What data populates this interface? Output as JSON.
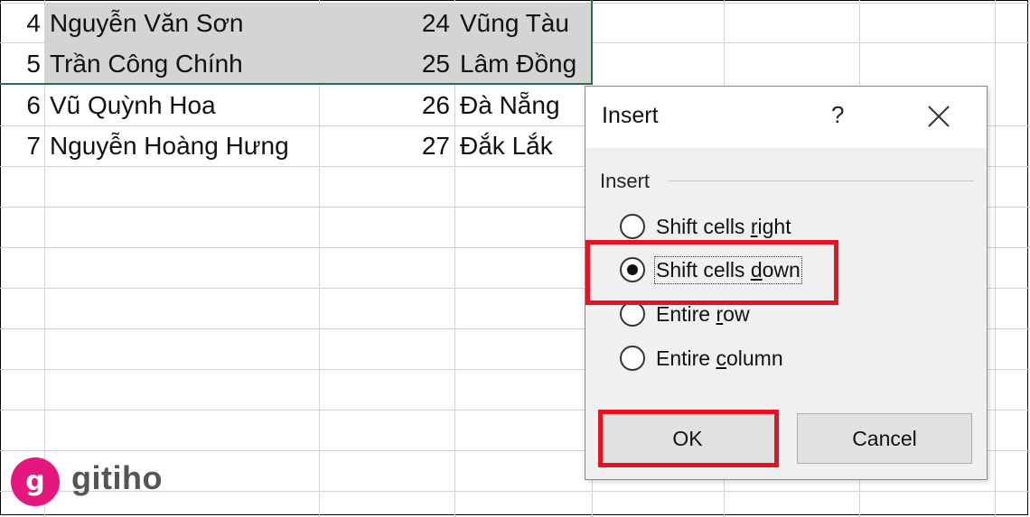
{
  "rows": [
    {
      "index": "4",
      "name": "Nguyễn Văn Sơn",
      "age": "24",
      "city": "Vũng Tàu"
    },
    {
      "index": "5",
      "name": "Trần Công Chính",
      "age": "25",
      "city": "Lâm Đồng"
    },
    {
      "index": "6",
      "name": "Vũ Quỳnh Hoa",
      "age": "26",
      "city": "Đà Nẵng"
    },
    {
      "index": "7",
      "name": "Nguyễn Hoàng Hưng",
      "age": "27",
      "city": "Đắk Lắk"
    }
  ],
  "dialog": {
    "title": "Insert",
    "help": "?",
    "group_label": "Insert",
    "options": [
      {
        "pre": "Shift cells ",
        "key": "r",
        "post": "ight",
        "checked": false
      },
      {
        "pre": "Shift cells ",
        "key": "d",
        "post": "own",
        "checked": true
      },
      {
        "pre": "Entire ",
        "key": "r",
        "post": "ow",
        "checked": false
      },
      {
        "pre": "Entire ",
        "key": "c",
        "post": "olumn",
        "checked": false
      }
    ],
    "ok_label": "OK",
    "cancel_label": "Cancel"
  },
  "logo": {
    "text": "gitiho",
    "mark": "g"
  },
  "colors": {
    "selection_fill": "#d4d4d4",
    "selection_border": "#217346",
    "highlight": "#e81123",
    "dialog_bg": "#f0f0f0",
    "logo_pink": "#e5177e"
  }
}
